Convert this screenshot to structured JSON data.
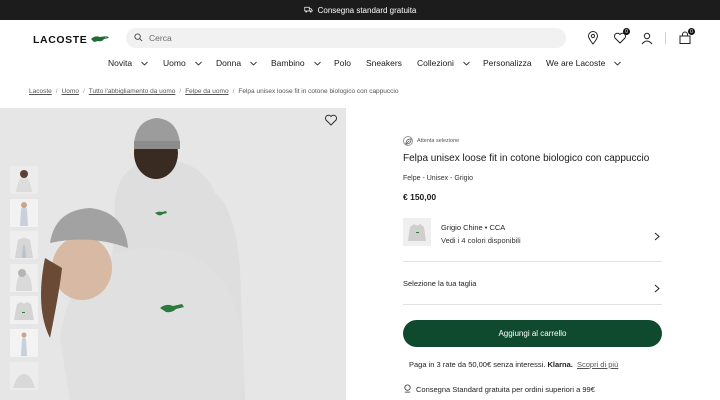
{
  "announcement": {
    "text": "Consegna standard gratuita",
    "icon": "delivery-truck-icon"
  },
  "header": {
    "logo_text": "LACOSTE",
    "logo_icon": "crocodile-icon",
    "search_placeholder": "Cerca",
    "icons": [
      "store-locator-icon",
      "heart-icon",
      "user-icon",
      "bag-icon"
    ],
    "wishlist_count": "0",
    "bag_count": "0"
  },
  "nav": {
    "items": [
      {
        "label": "Novita"
      },
      {
        "label": "Uomo"
      },
      {
        "label": "Donna"
      },
      {
        "label": "Bambino"
      },
      {
        "label": "Polo"
      },
      {
        "label": "Sneakers"
      },
      {
        "label": "Collezioni"
      },
      {
        "label": "Personalizza"
      },
      {
        "label": "We are Lacoste"
      }
    ]
  },
  "breadcrumb": {
    "items": [
      "Lacoste",
      "Uomo",
      "Tutto l'abbigliamento da uomo",
      "Felpe da uomo"
    ],
    "current": "Felpa unisex loose fit in cotone biologico con cappuccio"
  },
  "product": {
    "badge": "Attenta selezione",
    "title": "Felpa unisex loose fit in cotone biologico con cappuccio",
    "meta": "Felpe - Unisex - Grigio",
    "price": "€ 150,00",
    "color_name": "Grigio Chine • CCA",
    "color_count": "Vedi i 4 colori disponibili",
    "size_label": "Selezione la tua taglia",
    "cart_button": "Aggiungi al carrello",
    "klarna_text": "Paga in 3 rate da 50,00€ senza interessi.",
    "klarna_brand": "Klarna.",
    "klarna_link": "Scopri di più",
    "shipping_text": "Consegna Standard gratuita per ordini superiori a 99€"
  },
  "colors": {
    "cta": "#0f4a2e",
    "topbar": "#1c1c1c",
    "sweatshirt": "#e2e2e2"
  }
}
